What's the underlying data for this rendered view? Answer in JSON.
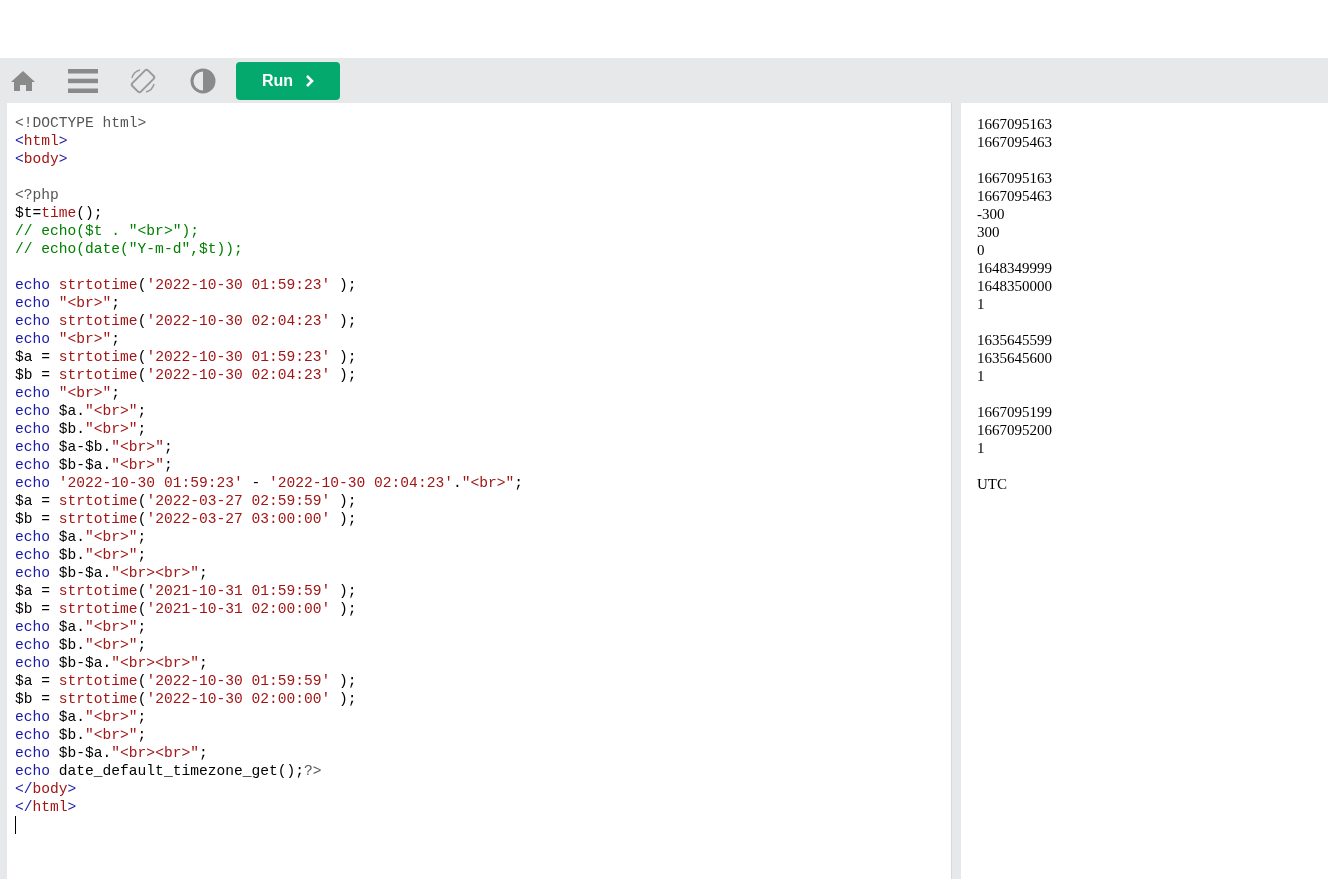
{
  "toolbar": {
    "run_button": {
      "label": "Run"
    }
  },
  "editor": {
    "lines": [
      {
        "kind": "code",
        "tokens": [
          {
            "kind": "meta",
            "text": "<!DOCTYPE html>"
          }
        ]
      },
      {
        "kind": "code",
        "tokens": [
          {
            "kind": "bracket",
            "text": "<"
          },
          {
            "kind": "tagname",
            "text": "html"
          },
          {
            "kind": "bracket",
            "text": ">"
          }
        ]
      },
      {
        "kind": "code",
        "tokens": [
          {
            "kind": "bracket",
            "text": "<"
          },
          {
            "kind": "tagname",
            "text": "body"
          },
          {
            "kind": "bracket",
            "text": ">"
          }
        ]
      },
      {
        "kind": "blank"
      },
      {
        "kind": "code",
        "tokens": [
          {
            "kind": "meta",
            "text": "<?php"
          }
        ]
      },
      {
        "kind": "code",
        "tokens": [
          {
            "kind": "plain",
            "text": "$t="
          },
          {
            "kind": "function",
            "text": "time"
          },
          {
            "kind": "plain",
            "text": "();"
          }
        ]
      },
      {
        "kind": "code",
        "tokens": [
          {
            "kind": "comment",
            "text": "// echo($t . \"<br>\");"
          }
        ]
      },
      {
        "kind": "code",
        "tokens": [
          {
            "kind": "comment",
            "text": "// echo(date(\"Y-m-d\",$t));"
          }
        ]
      },
      {
        "kind": "blank"
      },
      {
        "kind": "code",
        "tokens": [
          {
            "kind": "keyword",
            "text": "echo "
          },
          {
            "kind": "function",
            "text": "strtotime"
          },
          {
            "kind": "plain",
            "text": "("
          },
          {
            "kind": "string",
            "text": "'2022-10-30 01:59:23'"
          },
          {
            "kind": "plain",
            "text": " );"
          }
        ]
      },
      {
        "kind": "code",
        "tokens": [
          {
            "kind": "keyword",
            "text": "echo "
          },
          {
            "kind": "string",
            "text": "\"<br>\""
          },
          {
            "kind": "plain",
            "text": ";"
          }
        ]
      },
      {
        "kind": "code",
        "tokens": [
          {
            "kind": "keyword",
            "text": "echo "
          },
          {
            "kind": "function",
            "text": "strtotime"
          },
          {
            "kind": "plain",
            "text": "("
          },
          {
            "kind": "string",
            "text": "'2022-10-30 02:04:23'"
          },
          {
            "kind": "plain",
            "text": " );"
          }
        ]
      },
      {
        "kind": "code",
        "tokens": [
          {
            "kind": "keyword",
            "text": "echo "
          },
          {
            "kind": "string",
            "text": "\"<br>\""
          },
          {
            "kind": "plain",
            "text": ";"
          }
        ]
      },
      {
        "kind": "code",
        "tokens": [
          {
            "kind": "plain",
            "text": "$a = "
          },
          {
            "kind": "function",
            "text": "strtotime"
          },
          {
            "kind": "plain",
            "text": "("
          },
          {
            "kind": "string",
            "text": "'2022-10-30 01:59:23'"
          },
          {
            "kind": "plain",
            "text": " );"
          }
        ]
      },
      {
        "kind": "code",
        "tokens": [
          {
            "kind": "plain",
            "text": "$b = "
          },
          {
            "kind": "function",
            "text": "strtotime"
          },
          {
            "kind": "plain",
            "text": "("
          },
          {
            "kind": "string",
            "text": "'2022-10-30 02:04:23'"
          },
          {
            "kind": "plain",
            "text": " );"
          }
        ]
      },
      {
        "kind": "code",
        "tokens": [
          {
            "kind": "keyword",
            "text": "echo "
          },
          {
            "kind": "string",
            "text": "\"<br>\""
          },
          {
            "kind": "plain",
            "text": ";"
          }
        ]
      },
      {
        "kind": "code",
        "tokens": [
          {
            "kind": "keyword",
            "text": "echo"
          },
          {
            "kind": "plain",
            "text": " $a."
          },
          {
            "kind": "string",
            "text": "\"<br>\""
          },
          {
            "kind": "plain",
            "text": ";"
          }
        ]
      },
      {
        "kind": "code",
        "tokens": [
          {
            "kind": "keyword",
            "text": "echo"
          },
          {
            "kind": "plain",
            "text": " $b."
          },
          {
            "kind": "string",
            "text": "\"<br>\""
          },
          {
            "kind": "plain",
            "text": ";"
          }
        ]
      },
      {
        "kind": "code",
        "tokens": [
          {
            "kind": "keyword",
            "text": "echo"
          },
          {
            "kind": "plain",
            "text": " $a-$b."
          },
          {
            "kind": "string",
            "text": "\"<br>\""
          },
          {
            "kind": "plain",
            "text": ";"
          }
        ]
      },
      {
        "kind": "code",
        "tokens": [
          {
            "kind": "keyword",
            "text": "echo"
          },
          {
            "kind": "plain",
            "text": " $b-$a."
          },
          {
            "kind": "string",
            "text": "\"<br>\""
          },
          {
            "kind": "plain",
            "text": ";"
          }
        ]
      },
      {
        "kind": "code",
        "tokens": [
          {
            "kind": "keyword",
            "text": "echo "
          },
          {
            "kind": "string",
            "text": "'2022-10-30 01:59:23'"
          },
          {
            "kind": "plain",
            "text": " - "
          },
          {
            "kind": "string",
            "text": "'2022-10-30 02:04:23'"
          },
          {
            "kind": "plain",
            "text": "."
          },
          {
            "kind": "string",
            "text": "\"<br>\""
          },
          {
            "kind": "plain",
            "text": ";"
          }
        ]
      },
      {
        "kind": "code",
        "tokens": [
          {
            "kind": "plain",
            "text": "$a = "
          },
          {
            "kind": "function",
            "text": "strtotime"
          },
          {
            "kind": "plain",
            "text": "("
          },
          {
            "kind": "string",
            "text": "'2022-03-27 02:59:59'"
          },
          {
            "kind": "plain",
            "text": " );"
          }
        ]
      },
      {
        "kind": "code",
        "tokens": [
          {
            "kind": "plain",
            "text": "$b = "
          },
          {
            "kind": "function",
            "text": "strtotime"
          },
          {
            "kind": "plain",
            "text": "("
          },
          {
            "kind": "string",
            "text": "'2022-03-27 03:00:00'"
          },
          {
            "kind": "plain",
            "text": " );"
          }
        ]
      },
      {
        "kind": "code",
        "tokens": [
          {
            "kind": "keyword",
            "text": "echo"
          },
          {
            "kind": "plain",
            "text": " $a."
          },
          {
            "kind": "string",
            "text": "\"<br>\""
          },
          {
            "kind": "plain",
            "text": ";"
          }
        ]
      },
      {
        "kind": "code",
        "tokens": [
          {
            "kind": "keyword",
            "text": "echo"
          },
          {
            "kind": "plain",
            "text": " $b."
          },
          {
            "kind": "string",
            "text": "\"<br>\""
          },
          {
            "kind": "plain",
            "text": ";"
          }
        ]
      },
      {
        "kind": "code",
        "tokens": [
          {
            "kind": "keyword",
            "text": "echo"
          },
          {
            "kind": "plain",
            "text": " $b-$a."
          },
          {
            "kind": "string",
            "text": "\"<br><br>\""
          },
          {
            "kind": "plain",
            "text": ";"
          }
        ]
      },
      {
        "kind": "code",
        "tokens": [
          {
            "kind": "plain",
            "text": "$a = "
          },
          {
            "kind": "function",
            "text": "strtotime"
          },
          {
            "kind": "plain",
            "text": "("
          },
          {
            "kind": "string",
            "text": "'2021-10-31 01:59:59'"
          },
          {
            "kind": "plain",
            "text": " );"
          }
        ]
      },
      {
        "kind": "code",
        "tokens": [
          {
            "kind": "plain",
            "text": "$b = "
          },
          {
            "kind": "function",
            "text": "strtotime"
          },
          {
            "kind": "plain",
            "text": "("
          },
          {
            "kind": "string",
            "text": "'2021-10-31 02:00:00'"
          },
          {
            "kind": "plain",
            "text": " );"
          }
        ]
      },
      {
        "kind": "code",
        "tokens": [
          {
            "kind": "keyword",
            "text": "echo"
          },
          {
            "kind": "plain",
            "text": " $a."
          },
          {
            "kind": "string",
            "text": "\"<br>\""
          },
          {
            "kind": "plain",
            "text": ";"
          }
        ]
      },
      {
        "kind": "code",
        "tokens": [
          {
            "kind": "keyword",
            "text": "echo"
          },
          {
            "kind": "plain",
            "text": " $b."
          },
          {
            "kind": "string",
            "text": "\"<br>\""
          },
          {
            "kind": "plain",
            "text": ";"
          }
        ]
      },
      {
        "kind": "code",
        "tokens": [
          {
            "kind": "keyword",
            "text": "echo"
          },
          {
            "kind": "plain",
            "text": " $b-$a."
          },
          {
            "kind": "string",
            "text": "\"<br><br>\""
          },
          {
            "kind": "plain",
            "text": ";"
          }
        ]
      },
      {
        "kind": "code",
        "tokens": [
          {
            "kind": "plain",
            "text": "$a = "
          },
          {
            "kind": "function",
            "text": "strtotime"
          },
          {
            "kind": "plain",
            "text": "("
          },
          {
            "kind": "string",
            "text": "'2022-10-30 01:59:59'"
          },
          {
            "kind": "plain",
            "text": " );"
          }
        ]
      },
      {
        "kind": "code",
        "tokens": [
          {
            "kind": "plain",
            "text": "$b = "
          },
          {
            "kind": "function",
            "text": "strtotime"
          },
          {
            "kind": "plain",
            "text": "("
          },
          {
            "kind": "string",
            "text": "'2022-10-30 02:00:00'"
          },
          {
            "kind": "plain",
            "text": " );"
          }
        ]
      },
      {
        "kind": "code",
        "tokens": [
          {
            "kind": "keyword",
            "text": "echo"
          },
          {
            "kind": "plain",
            "text": " $a."
          },
          {
            "kind": "string",
            "text": "\"<br>\""
          },
          {
            "kind": "plain",
            "text": ";"
          }
        ]
      },
      {
        "kind": "code",
        "tokens": [
          {
            "kind": "keyword",
            "text": "echo"
          },
          {
            "kind": "plain",
            "text": " $b."
          },
          {
            "kind": "string",
            "text": "\"<br>\""
          },
          {
            "kind": "plain",
            "text": ";"
          }
        ]
      },
      {
        "kind": "code",
        "tokens": [
          {
            "kind": "keyword",
            "text": "echo"
          },
          {
            "kind": "plain",
            "text": " $b-$a."
          },
          {
            "kind": "string",
            "text": "\"<br><br>\""
          },
          {
            "kind": "plain",
            "text": ";"
          }
        ]
      },
      {
        "kind": "code",
        "tokens": [
          {
            "kind": "keyword",
            "text": "echo"
          },
          {
            "kind": "plain",
            "text": " date_default_timezone_get();"
          },
          {
            "kind": "meta",
            "text": "?>"
          }
        ]
      },
      {
        "kind": "code",
        "tokens": [
          {
            "kind": "bracket",
            "text": "</"
          },
          {
            "kind": "tagname",
            "text": "body"
          },
          {
            "kind": "bracket",
            "text": ">"
          }
        ]
      },
      {
        "kind": "code",
        "tokens": [
          {
            "kind": "bracket",
            "text": "</"
          },
          {
            "kind": "tagname",
            "text": "html"
          },
          {
            "kind": "bracket",
            "text": ">"
          }
        ]
      },
      {
        "kind": "cursor"
      }
    ]
  },
  "output": {
    "blocks": [
      [
        "1667095163",
        "1667095463"
      ],
      [
        "1667095163",
        "1667095463",
        "-300",
        "300",
        "0",
        "1648349999",
        "1648350000",
        "1"
      ],
      [
        "1635645599",
        "1635645600",
        "1"
      ],
      [
        "1667095199",
        "1667095200",
        "1"
      ],
      [
        "UTC"
      ]
    ]
  }
}
